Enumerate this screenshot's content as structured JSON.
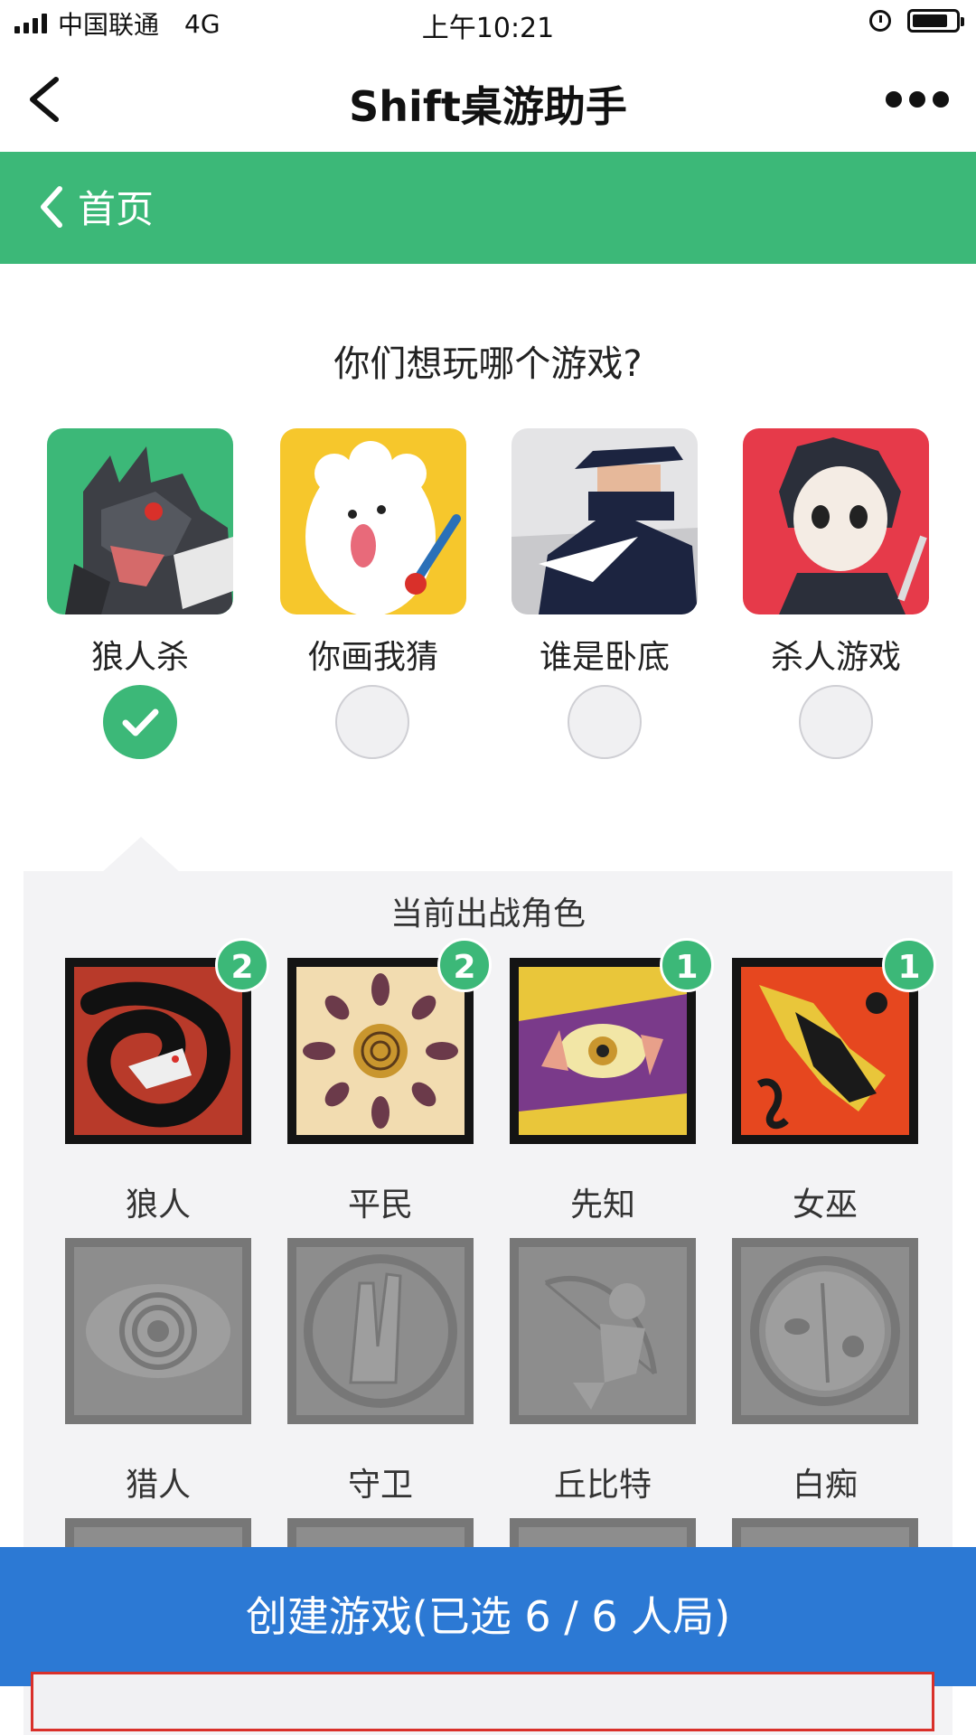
{
  "status_bar": {
    "carrier": "中国联通",
    "network": "4G",
    "time": "上午10:21"
  },
  "nav": {
    "title": "Shift桌游助手"
  },
  "home": {
    "label": "首页"
  },
  "question": "你们想玩哪个游戏?",
  "games": [
    {
      "label": "狼人杀",
      "selected": true
    },
    {
      "label": "你画我猜",
      "selected": false
    },
    {
      "label": "谁是卧底",
      "selected": false
    },
    {
      "label": "杀人游戏",
      "selected": false
    }
  ],
  "roles_title": "当前出战角色",
  "roles": [
    {
      "label": "狼人",
      "count": "2",
      "active": true
    },
    {
      "label": "平民",
      "count": "2",
      "active": true
    },
    {
      "label": "先知",
      "count": "1",
      "active": true
    },
    {
      "label": "女巫",
      "count": "1",
      "active": true
    },
    {
      "label": "猎人",
      "active": false
    },
    {
      "label": "守卫",
      "active": false
    },
    {
      "label": "丘比特",
      "active": false
    },
    {
      "label": "白痴",
      "active": false
    }
  ],
  "create_button": {
    "label": "创建游戏(已选 6 / 6 人局)"
  },
  "colors": {
    "green": "#3cb878",
    "blue": "#2c79d4",
    "highlight": "#d9302a"
  }
}
